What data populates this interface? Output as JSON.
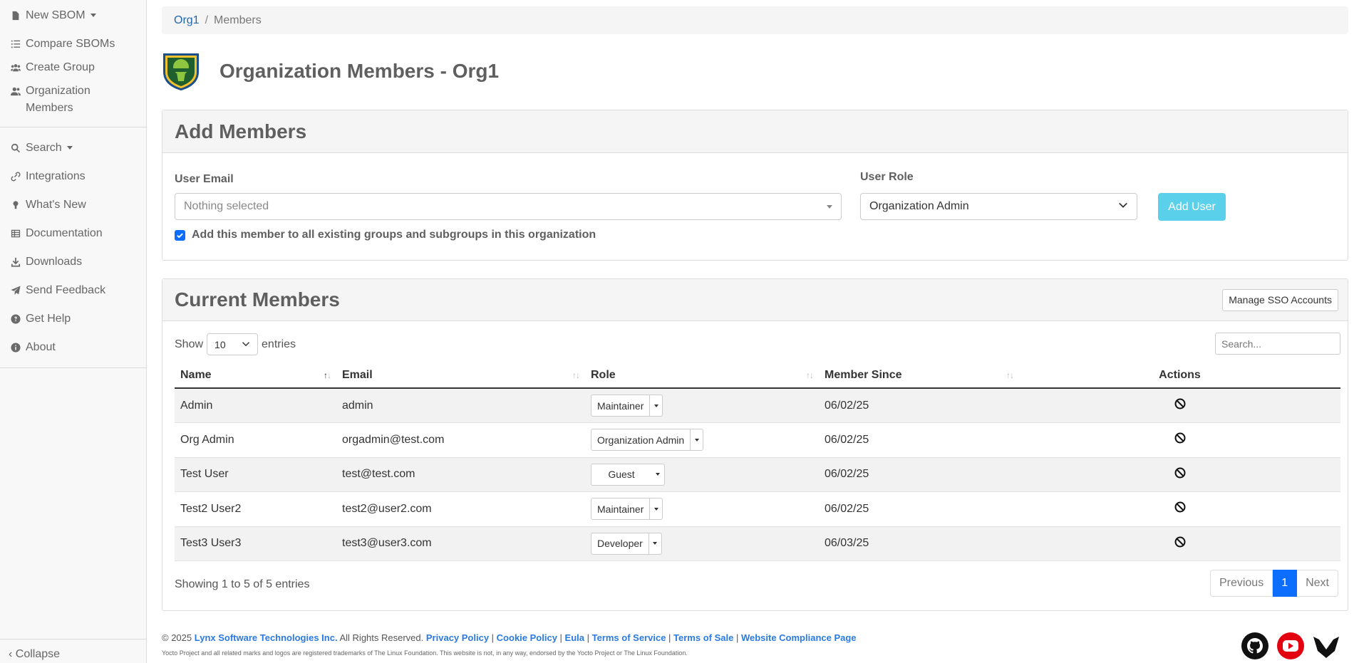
{
  "sidebar": {
    "items": [
      {
        "label": "New SBOM",
        "icon": "file-icon"
      },
      {
        "label": "Compare SBOMs",
        "icon": "list-check-icon"
      },
      {
        "label": "Create Group",
        "icon": "users-icon"
      },
      {
        "label": "Organization",
        "label2": "Members",
        "icon": "user-group-icon"
      },
      {
        "label": "Search",
        "icon": "search-icon"
      },
      {
        "label": "Integrations",
        "icon": "link-icon"
      },
      {
        "label": "What's New",
        "icon": "lightbulb-icon"
      },
      {
        "label": "Documentation",
        "icon": "table-icon"
      },
      {
        "label": "Downloads",
        "icon": "download-icon"
      },
      {
        "label": "Send Feedback",
        "icon": "paper-plane-icon"
      },
      {
        "label": "Get Help",
        "icon": "question-circle-icon"
      },
      {
        "label": "About",
        "icon": "info-circle-icon"
      }
    ],
    "collapse": "Collapse"
  },
  "breadcrumb": {
    "org": "Org1",
    "current": "Members"
  },
  "page": {
    "title": "Organization Members - Org1"
  },
  "add_members": {
    "title": "Add Members",
    "email_label": "User Email",
    "email_placeholder": "Nothing selected",
    "role_label": "User Role",
    "role_value": "Organization Admin",
    "add_button": "Add User",
    "checkbox_label": "Add this member to all existing groups and subgroups in this organization",
    "checkbox_checked": true
  },
  "current_members": {
    "title": "Current Members",
    "sso_button": "Manage SSO Accounts",
    "show_label": "Show",
    "entries_label": "entries",
    "page_length": "10",
    "search_placeholder": "Search...",
    "columns": [
      "Name",
      "Email",
      "Role",
      "Member Since",
      "Actions"
    ],
    "rows": [
      {
        "name": "Admin",
        "email": "admin",
        "role": "Maintainer",
        "since": "06/02/25"
      },
      {
        "name": "Org Admin",
        "email": "orgadmin@test.com",
        "role": "Organization Admin",
        "since": "06/02/25"
      },
      {
        "name": "Test User",
        "email": "test@test.com",
        "role": "Guest",
        "since": "06/02/25"
      },
      {
        "name": "Test2 User2",
        "email": "test2@user2.com",
        "role": "Maintainer",
        "since": "06/02/25"
      },
      {
        "name": "Test3 User3",
        "email": "test3@user3.com",
        "role": "Developer",
        "since": "06/03/25"
      }
    ],
    "info": "Showing 1 to 5 of 5 entries",
    "pager": {
      "previous": "Previous",
      "page": "1",
      "next": "Next"
    }
  },
  "footer": {
    "copyright": "© 2025",
    "company": "Lynx Software Technologies Inc.",
    "rights": "All Rights Reserved.",
    "links": [
      "Privacy Policy",
      "Cookie Policy",
      "Eula",
      "Terms of Service",
      "Terms of Sale",
      "Website Compliance Page"
    ],
    "fine_print": "Yocto Project and all related marks and logos are registered trademarks of The Linux Foundation. This website is not, in any way, endorsed by the Yocto Project or The Linux Foundation."
  },
  "social": [
    "github-icon",
    "youtube-icon",
    "lynx-logo-icon"
  ],
  "colors": {
    "accent": "#0d6efd",
    "add_button": "#5bd0ea",
    "link": "#2a7ae2"
  }
}
